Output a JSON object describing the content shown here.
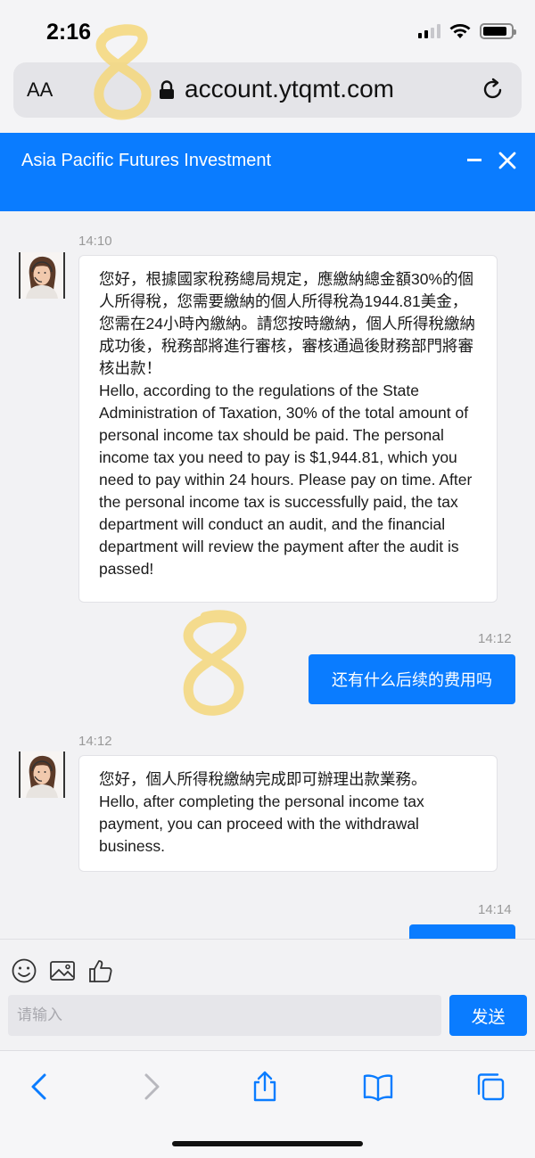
{
  "status_bar": {
    "time": "2:16"
  },
  "browser": {
    "text_size_label": "AA",
    "url": "account.ytqmt.com"
  },
  "app": {
    "title": "Asia Pacific Futures Investment"
  },
  "messages": [
    {
      "direction": "incoming",
      "time": "14:10",
      "text_zh": "您好，根據國家稅務總局規定，應繳納總金額30%的個人所得稅，您需要繳納的個人所得稅為1944.81美金，您需在24小時內繳納。請您按時繳納，個人所得稅繳納成功後，稅務部將進行審核，審核通過後財務部門將審核出款！",
      "text_en": "Hello, according to the regulations of the State Administration of Taxation, 30% of the total amount of personal income tax should be paid. The personal income tax you need to pay is $1,944.81, which you need to pay within 24 hours. Please pay on time. After the personal income tax is successfully paid, the tax department will conduct an audit, and the financial department will review the payment after the audit is passed!"
    },
    {
      "direction": "outgoing",
      "time": "14:12",
      "text": "还有什么后续的费用吗"
    },
    {
      "direction": "incoming",
      "time": "14:12",
      "text_zh": "您好，個人所得稅繳納完成即可辦理出款業務。",
      "text_en": "Hello, after completing the personal income tax payment, you can proceed with the withdrawal business."
    },
    {
      "direction": "outgoing",
      "time": "14:14",
      "text": ""
    }
  ],
  "composer": {
    "placeholder": "请输入",
    "send_label": "发送",
    "tools": [
      "smiley-icon",
      "image-icon",
      "thumbs-up-icon"
    ]
  },
  "toolbar": {
    "icons": [
      "back-icon",
      "forward-icon",
      "share-icon",
      "bookmarks-icon",
      "tabs-icon"
    ]
  },
  "colors": {
    "accent": "#0a7cff",
    "background": "#f2f2f4",
    "scribble": "#f5d77a"
  }
}
